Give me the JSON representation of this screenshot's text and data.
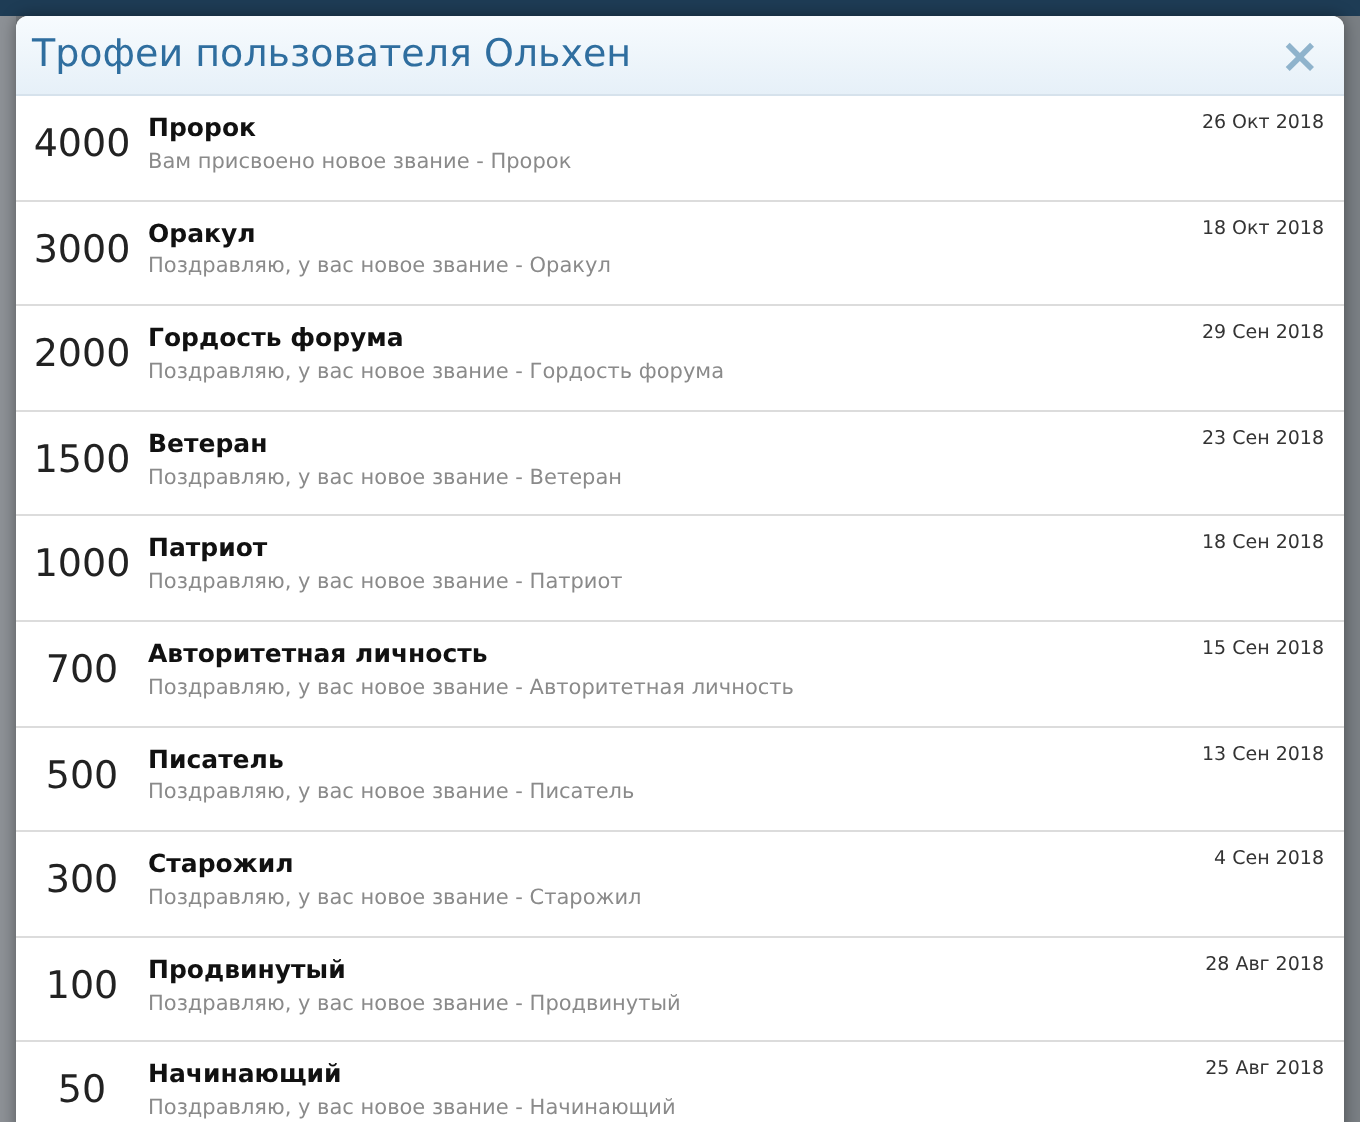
{
  "dialog": {
    "title": "Трофеи пользователя Ольхен",
    "close": "×"
  },
  "trophies": [
    {
      "points": "4000",
      "name": "Пророк",
      "description": "Вам присвоено новое звание - Пророк",
      "date": "26 Окт 2018"
    },
    {
      "points": "3000",
      "name": "Оракул",
      "description": "Поздравляю, у вас новое звание - Оракул",
      "date": "18 Окт 2018"
    },
    {
      "points": "2000",
      "name": "Гордость форума",
      "description": "Поздравляю, у вас новое звание - Гордость форума",
      "date": "29 Сен 2018"
    },
    {
      "points": "1500",
      "name": "Ветеран",
      "description": "Поздравляю, у вас новое звание - Ветеран",
      "date": "23 Сен 2018"
    },
    {
      "points": "1000",
      "name": "Патриот",
      "description": "Поздравляю, у вас новое звание - Патриот",
      "date": "18 Сен 2018"
    },
    {
      "points": "700",
      "name": "Авторитетная личность",
      "description": "Поздравляю, у вас новое звание - Авторитетная личность",
      "date": "15 Сен 2018"
    },
    {
      "points": "500",
      "name": "Писатель",
      "description": "Поздравляю, у вас новое звание - Писатель",
      "date": "13 Сен 2018"
    },
    {
      "points": "300",
      "name": "Старожил",
      "description": "Поздравляю, у вас новое звание - Старожил",
      "date": "4 Сен 2018"
    },
    {
      "points": "100",
      "name": "Продвинутый",
      "description": "Поздравляю, у вас новое звание - Продвинутый",
      "date": "28 Авг 2018"
    },
    {
      "points": "50",
      "name": "Начинающий",
      "description": "Поздравляю, у вас новое звание - Начинающий",
      "date": "25 Авг 2018"
    }
  ]
}
